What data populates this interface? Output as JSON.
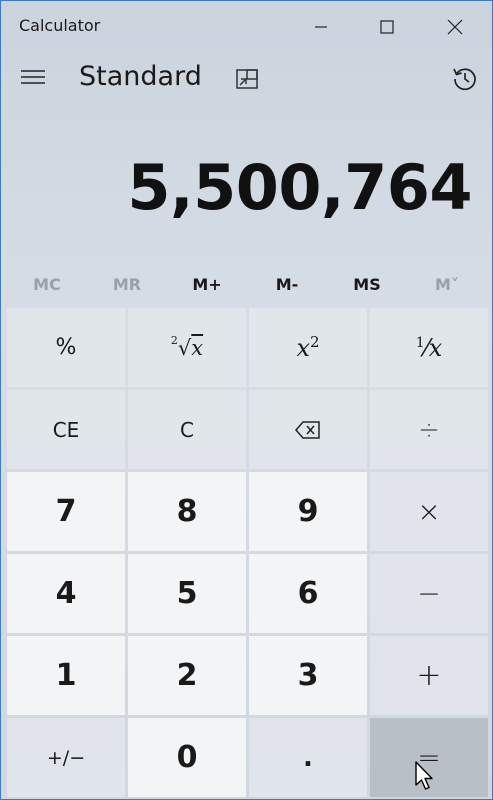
{
  "window": {
    "title": "Calculator",
    "controls": [
      "minimize-icon",
      "maximize-icon",
      "close-icon"
    ]
  },
  "header": {
    "mode": "Standard",
    "icons": [
      "hamburger-icon",
      "keep-on-top-icon",
      "history-icon"
    ]
  },
  "display": {
    "value": "5,500,764"
  },
  "memory": {
    "mc": "MC",
    "mr": "MR",
    "mplus": "M+",
    "mminus": "M-",
    "ms": "MS",
    "mlist": "M˅"
  },
  "keys": {
    "percent": "%",
    "sqrt_index": "2",
    "sqrt_x": "x",
    "square_base": "x",
    "square_exp": "2",
    "recip_num": "1",
    "recip_den": "x",
    "ce": "CE",
    "c": "C",
    "divide": "÷",
    "seven": "7",
    "eight": "8",
    "nine": "9",
    "multiply": "×",
    "four": "4",
    "five": "5",
    "six": "6",
    "minus": "−",
    "one": "1",
    "two": "2",
    "three": "3",
    "plus": "+",
    "negate": "+/−",
    "zero": "0",
    "decimal": ".",
    "equals": "="
  },
  "colors": {
    "window_border": "#3c7bc4",
    "number_key_bg": "#f3f4f6",
    "operator_key_bg": "#e2e6eb",
    "equals_key_hover_bg": "#b9bfc7",
    "memory_disabled": "#9aa0a8"
  }
}
